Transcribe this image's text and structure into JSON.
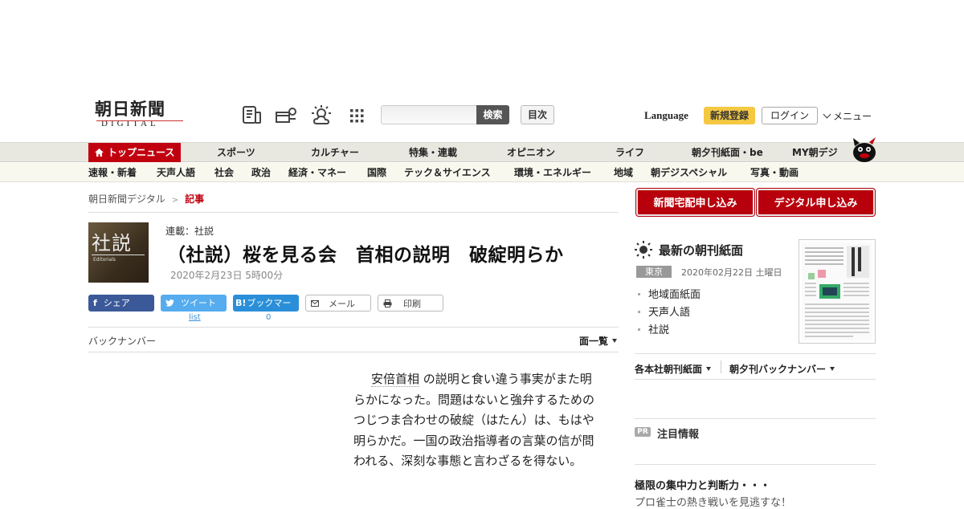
{
  "header": {
    "logo_main": "朝日新聞",
    "logo_sub": "DIGITAL",
    "search_button": "検索",
    "toc_button": "目次",
    "language": "Language",
    "register": "新規登録",
    "login": "ログイン",
    "menu": "メニュー",
    "icons": [
      "news-icon",
      "delivery-icon",
      "weather-icon",
      "grid-icon"
    ]
  },
  "nav_main": [
    "トップニュース",
    "スポーツ",
    "カルチャー",
    "特集・連載",
    "オピニオン",
    "ライフ",
    "朝夕刊紙面・be",
    "MY朝デジ"
  ],
  "nav_sub": [
    "速報・新着",
    "天声人語",
    "社会",
    "政治",
    "経済・マネー",
    "国際",
    "テック＆サイエンス",
    "環境・エネルギー",
    "地域",
    "朝デジスペシャル",
    "写真・動画"
  ],
  "breadcrumb": {
    "home": "朝日新聞デジタル",
    "current": "記事"
  },
  "article": {
    "thumb_kanji": "社説",
    "thumb_en": "Editorials",
    "series": "連載：社説",
    "title": "（社説）桜を見る会　首相の説明　破綻明らか",
    "date": "2020年2月23日 5時00分",
    "body_link": "安倍首相",
    "body_rest": " の説明と食い違う事実がまた明らかになった。問題はないと強弁するためのつじつま合わせの破綻（はたん）は、もはや明らかだ。一国の政治指導者の言葉の信が問われる、深刻な事態と言わざるを得ない。"
  },
  "share": {
    "facebook": "シェア",
    "twitter": "ツイート",
    "twitter_sub": "list",
    "hatena": "ブックマーク",
    "hatena_count": "0",
    "mail": "メール",
    "print": "印刷"
  },
  "backnumber": {
    "label": "バックナンバー",
    "pagelist": "面一覧"
  },
  "sidebar": {
    "btn_paper": "新聞宅配申し込み",
    "btn_digital": "デジタル申し込み",
    "latest_title": "最新の朝刊紙面",
    "region": "東京",
    "paper_date": "2020年02月22日 土曜日",
    "paper_links": [
      "地域面紙面",
      "天声人語",
      "社説"
    ],
    "link_regional": "各本社朝刊紙面",
    "link_backnumber": "朝夕刊バックナンバー",
    "pr_badge": "PR",
    "pr_title": "注目情報",
    "ad_title": "極限の集中力と判断力・・・",
    "ad_sub": "プロ雀士の熱き戦いを見逃すな！"
  },
  "colors": {
    "accent_red": "#c1000f",
    "facebook": "#3b5998",
    "twitter": "#55acee",
    "hatena": "#2a8fd8",
    "register": "#f5c842"
  }
}
